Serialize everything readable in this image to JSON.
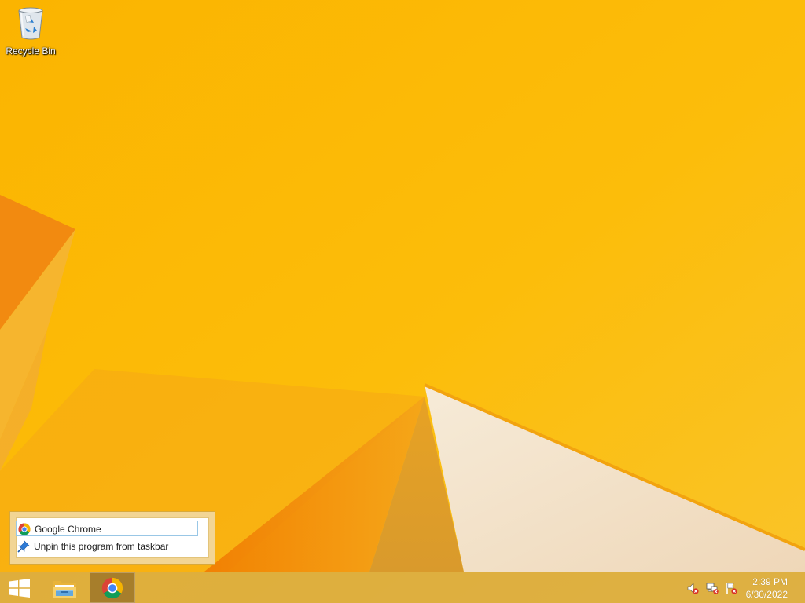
{
  "desktop": {
    "icons": [
      {
        "label": "Recycle Bin",
        "icon": "recycle-bin-icon"
      }
    ]
  },
  "jumplist": {
    "items": [
      {
        "label": "Google Chrome",
        "icon": "chrome-icon",
        "highlighted": true
      },
      {
        "label": "Unpin this program from taskbar",
        "icon": "unpin-icon",
        "highlighted": false
      }
    ]
  },
  "taskbar": {
    "pinned": [
      {
        "name": "Start",
        "icon": "windows-logo-icon"
      },
      {
        "name": "File Explorer",
        "icon": "folder-icon"
      },
      {
        "name": "Google Chrome",
        "icon": "chrome-icon",
        "active": true
      }
    ],
    "tray": [
      {
        "icon": "speaker-muted-icon"
      },
      {
        "icon": "network-disconnected-icon"
      },
      {
        "icon": "action-center-flag-icon"
      }
    ],
    "clock": {
      "time": "2:39 PM",
      "date": "6/30/2022"
    }
  },
  "colors": {
    "wallpaper_base": "#fbb900",
    "wallpaper_orange": "#f08a00",
    "taskbar": "#d6aa4a",
    "jumplist_frame": "#f2d594",
    "highlight_border": "#99c7e6"
  }
}
